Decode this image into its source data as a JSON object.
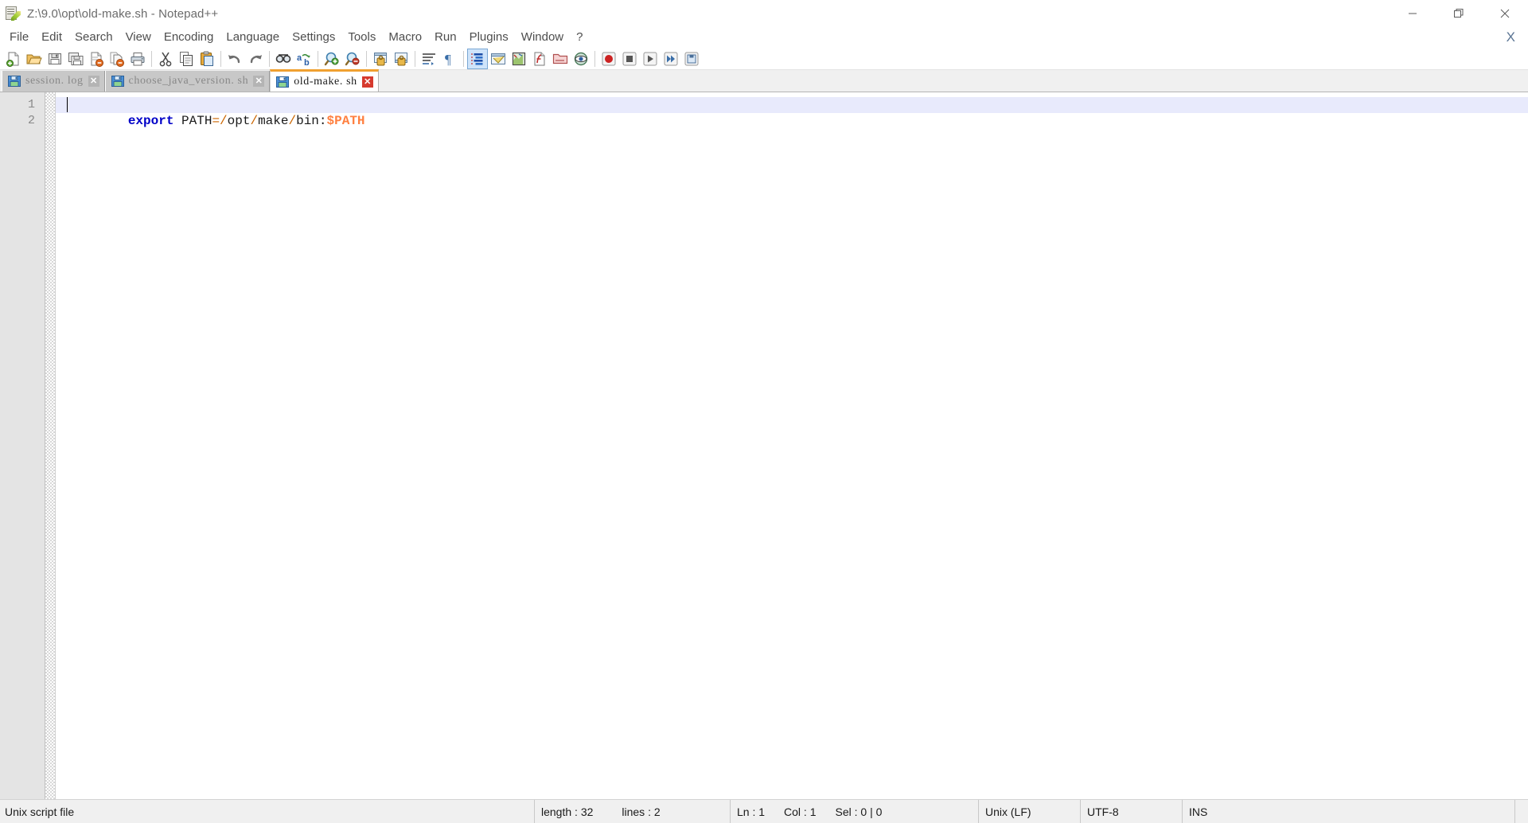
{
  "window": {
    "title": "Z:\\9.0\\opt\\old-make.sh - Notepad++",
    "icon": "notepad-plus-plus-icon",
    "controls": {
      "minimize": "minimize-icon",
      "restore": "restore-icon",
      "close": "close-icon"
    }
  },
  "menubar": {
    "items": [
      {
        "label": "File"
      },
      {
        "label": "Edit"
      },
      {
        "label": "Search"
      },
      {
        "label": "View"
      },
      {
        "label": "Encoding"
      },
      {
        "label": "Language"
      },
      {
        "label": "Settings"
      },
      {
        "label": "Tools"
      },
      {
        "label": "Macro"
      },
      {
        "label": "Run"
      },
      {
        "label": "Plugins"
      },
      {
        "label": "Window"
      },
      {
        "label": "?"
      }
    ],
    "close_document_label": "X"
  },
  "toolbar": {
    "items": [
      {
        "name": "new-file-icon",
        "tooltip": "New"
      },
      {
        "name": "open-file-icon",
        "tooltip": "Open"
      },
      {
        "name": "save-icon",
        "tooltip": "Save"
      },
      {
        "name": "save-all-icon",
        "tooltip": "Save All"
      },
      {
        "name": "close-file-icon",
        "tooltip": "Close"
      },
      {
        "name": "close-all-files-icon",
        "tooltip": "Close All"
      },
      {
        "name": "print-icon",
        "tooltip": "Print"
      },
      {
        "name": "separator-1",
        "tooltip": ""
      },
      {
        "name": "cut-icon",
        "tooltip": "Cut"
      },
      {
        "name": "copy-icon",
        "tooltip": "Copy"
      },
      {
        "name": "paste-icon",
        "tooltip": "Paste"
      },
      {
        "name": "separator-2",
        "tooltip": ""
      },
      {
        "name": "undo-icon",
        "tooltip": "Undo"
      },
      {
        "name": "redo-icon",
        "tooltip": "Redo"
      },
      {
        "name": "separator-3",
        "tooltip": ""
      },
      {
        "name": "find-icon",
        "tooltip": "Find"
      },
      {
        "name": "replace-icon",
        "tooltip": "Replace"
      },
      {
        "name": "separator-4",
        "tooltip": ""
      },
      {
        "name": "zoom-in-icon",
        "tooltip": "Zoom In"
      },
      {
        "name": "zoom-out-icon",
        "tooltip": "Zoom Out"
      },
      {
        "name": "separator-5",
        "tooltip": ""
      },
      {
        "name": "sync-vertical-scroll-icon",
        "tooltip": "Synchronize Vertical Scrolling"
      },
      {
        "name": "sync-horizontal-scroll-icon",
        "tooltip": "Synchronize Horizontal Scrolling"
      },
      {
        "name": "separator-6",
        "tooltip": ""
      },
      {
        "name": "word-wrap-icon",
        "tooltip": "Word wrap"
      },
      {
        "name": "show-all-characters-icon",
        "tooltip": "Show All Characters"
      },
      {
        "name": "separator-7",
        "tooltip": ""
      },
      {
        "name": "indent-guide-icon",
        "tooltip": "Show Indent Guide"
      },
      {
        "name": "user-defined-dialog-icon",
        "tooltip": "User Defined Dialogue"
      },
      {
        "name": "document-map-icon",
        "tooltip": "Document Map"
      },
      {
        "name": "function-list-icon",
        "tooltip": "Function List"
      },
      {
        "name": "folder-as-workspace-icon",
        "tooltip": "Folder as Workspace"
      },
      {
        "name": "monitoring-icon",
        "tooltip": "Monitoring"
      },
      {
        "name": "separator-8",
        "tooltip": ""
      },
      {
        "name": "record-macro-icon",
        "tooltip": "Start Recording"
      },
      {
        "name": "stop-macro-icon",
        "tooltip": "Stop Recording"
      },
      {
        "name": "play-macro-icon",
        "tooltip": "Playback"
      },
      {
        "name": "run-macro-multiple-icon",
        "tooltip": "Run a Macro Multiple Times"
      },
      {
        "name": "save-macro-icon",
        "tooltip": "Save Current Recorded Macro"
      }
    ],
    "active_item": "indent-guide-icon"
  },
  "tabs": [
    {
      "label": "session. log",
      "icon": "saved-file-icon",
      "close": "✕",
      "active": false
    },
    {
      "label": "choose_java_version. sh",
      "icon": "saved-file-icon",
      "close": "✕",
      "active": false
    },
    {
      "label": "old-make. sh",
      "icon": "saved-file-icon",
      "close": "✕",
      "active": true
    }
  ],
  "editor": {
    "line_numbers": [
      "1",
      "2"
    ],
    "lines": [
      {
        "current": true,
        "tokens": [
          {
            "text": "export",
            "type": "keyword"
          },
          {
            "text": " PATH",
            "type": "plain"
          },
          {
            "text": "=",
            "type": "operator"
          },
          {
            "text": "/",
            "type": "operator"
          },
          {
            "text": "opt",
            "type": "plain"
          },
          {
            "text": "/",
            "type": "operator"
          },
          {
            "text": "make",
            "type": "plain"
          },
          {
            "text": "/",
            "type": "operator"
          },
          {
            "text": "bin",
            "type": "plain"
          },
          {
            "text": ":",
            "type": "plain"
          },
          {
            "text": "$PATH",
            "type": "variable"
          }
        ]
      },
      {
        "current": false,
        "tokens": []
      }
    ]
  },
  "statusbar": {
    "document_type": "Unix script file",
    "length_label": "length : 32",
    "lines_label": "lines : 2",
    "ln_label": "Ln : 1",
    "col_label": "Col : 1",
    "sel_label": "Sel : 0 | 0",
    "eol": "Unix (LF)",
    "encoding": "UTF-8",
    "insert_mode": "INS"
  },
  "colors": {
    "accent_tab": "#f0a030",
    "keyword": "#0000c8",
    "operator": "#cc6600",
    "variable": "#ff8040",
    "current_line": "#e8eafc",
    "gutter": "#e4e4e4",
    "statusbar": "#f0f0f0"
  }
}
